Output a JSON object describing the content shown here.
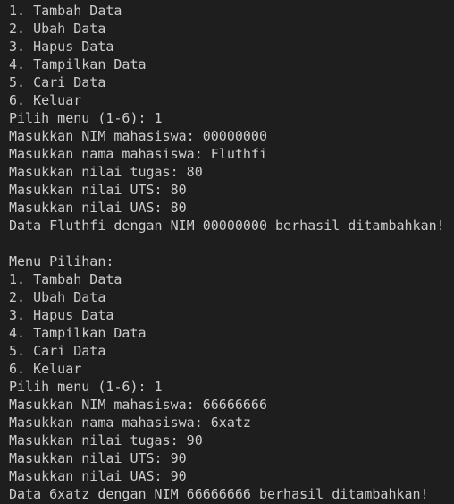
{
  "terminal": {
    "lines": [
      "1. Tambah Data",
      "2. Ubah Data",
      "3. Hapus Data",
      "4. Tampilkan Data",
      "5. Cari Data",
      "6. Keluar",
      "Pilih menu (1-6): 1",
      "Masukkan NIM mahasiswa: 00000000",
      "Masukkan nama mahasiswa: Fluthfi",
      "Masukkan nilai tugas: 80",
      "Masukkan nilai UTS: 80",
      "Masukkan nilai UAS: 80",
      "Data Fluthfi dengan NIM 00000000 berhasil ditambahkan!",
      "",
      "Menu Pilihan:",
      "1. Tambah Data",
      "2. Ubah Data",
      "3. Hapus Data",
      "4. Tampilkan Data",
      "5. Cari Data",
      "6. Keluar",
      "Pilih menu (1-6): 1",
      "Masukkan NIM mahasiswa: 66666666",
      "Masukkan nama mahasiswa: 6xatz",
      "Masukkan nilai tugas: 90",
      "Masukkan nilai UTS: 90",
      "Masukkan nilai UAS: 90",
      "Data 6xatz dengan NIM 66666666 berhasil ditambahkan!"
    ]
  }
}
